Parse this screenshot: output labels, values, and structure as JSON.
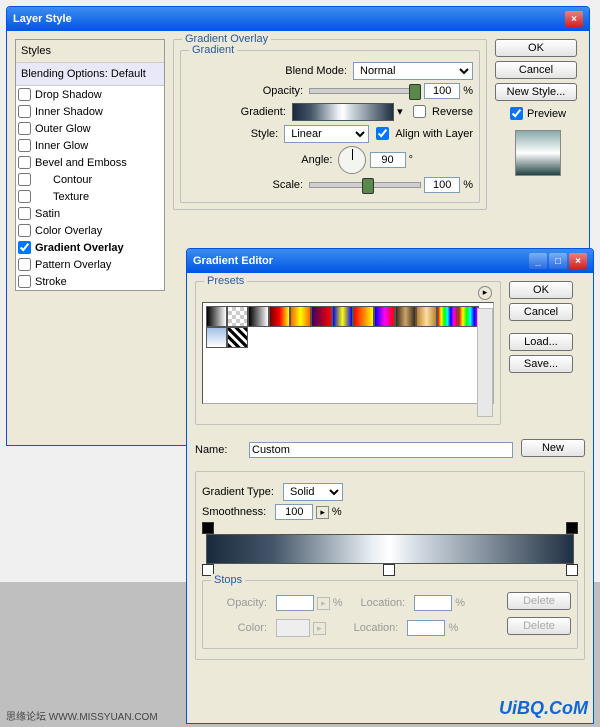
{
  "layerStyle": {
    "title": "Layer Style",
    "styles_header": "Styles",
    "blending_header": "Blending Options: Default",
    "effects": [
      "Drop Shadow",
      "Inner Shadow",
      "Outer Glow",
      "Inner Glow",
      "Bevel and Emboss",
      "Contour",
      "Texture",
      "Satin",
      "Color Overlay",
      "Gradient Overlay",
      "Pattern Overlay",
      "Stroke"
    ],
    "checked": "Gradient Overlay",
    "group_title": "Gradient Overlay",
    "sub_title": "Gradient",
    "blend_label": "Blend Mode:",
    "blend_value": "Normal",
    "opacity_label": "Opacity:",
    "opacity_value": "100",
    "pct": "%",
    "gradient_label": "Gradient:",
    "reverse_label": "Reverse",
    "style_label": "Style:",
    "style_value": "Linear",
    "align_label": "Align with Layer",
    "angle_label": "Angle:",
    "angle_value": "90",
    "deg": "°",
    "scale_label": "Scale:",
    "scale_value": "100",
    "ok": "OK",
    "cancel": "Cancel",
    "newstyle": "New Style...",
    "preview": "Preview"
  },
  "editor": {
    "title": "Gradient Editor",
    "presets_label": "Presets",
    "ok": "OK",
    "cancel": "Cancel",
    "load": "Load...",
    "save": "Save...",
    "name_label": "Name:",
    "name_value": "Custom",
    "new_btn": "New",
    "gtype_label": "Gradient Type:",
    "gtype_value": "Solid",
    "smooth_label": "Smoothness:",
    "smooth_value": "100",
    "pct": "%",
    "stops_label": "Stops",
    "stop_opacity": "Opacity:",
    "stop_location": "Location:",
    "stop_color": "Color:",
    "delete": "Delete"
  },
  "presets": [
    "linear-gradient(to right,#000,#fff)",
    "repeating-conic-gradient(#ccc 0 25%,#fff 0 50%) 0 0/8px 8px",
    "linear-gradient(to right,#000,#fff)",
    "linear-gradient(to right,#700,#f00,#ff0)",
    "linear-gradient(to right,#f60,#ff0,#f60)",
    "linear-gradient(to right,#400060,#f00)",
    "linear-gradient(to right,#00f,#ff0,#00f)",
    "linear-gradient(to right,#f00,#ff0)",
    "linear-gradient(to right,#00f,#f0f,#f00)",
    "linear-gradient(to right,#3a2a1a,#caa46a,#3a2a1a)",
    "linear-gradient(to right,#c08030,#f8e0a0,#c08030)",
    "linear-gradient(to right,#f00,#ff0,#0f0,#0ff,#00f,#f0f,#f00)",
    "linear-gradient(to right,#f00,#ff0,#0f0,#0ff,#00f,#f0f)",
    "linear-gradient(to bottom,#a0c0e8,#fff)",
    "repeating-linear-gradient(45deg,#000 0 3px,#fff 3px 6px)"
  ],
  "main_gradient": "linear-gradient(to right,#1a2a3e 0%,#435568 18%,#e8eef2 45%,#fff 50%,#d5dde5 57%,#1f3042 100%)",
  "watermark": "UiBQ.CoM",
  "footer": "思缘论坛   WWW.MISSYUAN.COM"
}
